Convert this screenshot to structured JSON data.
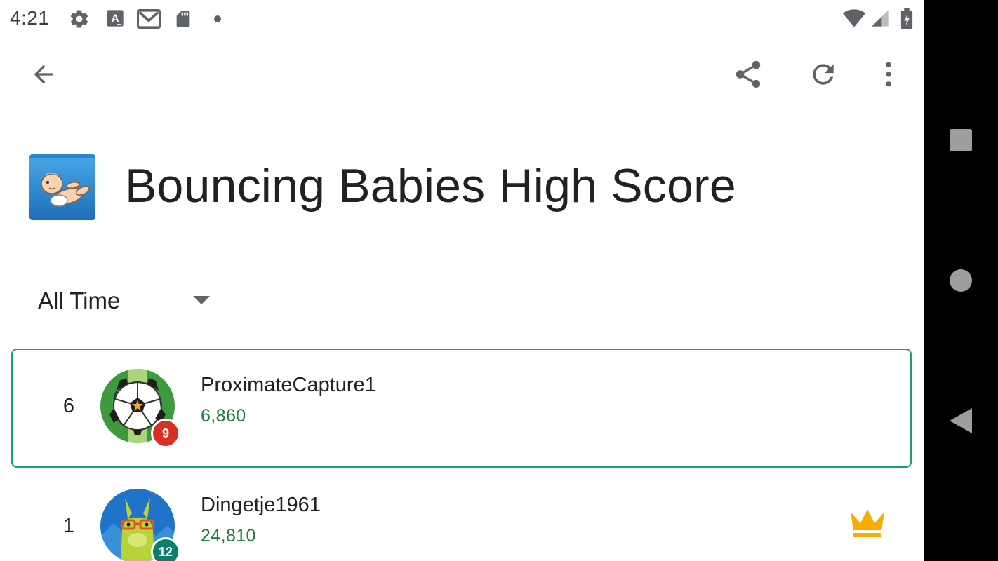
{
  "status_bar": {
    "time": "4:21",
    "icons": [
      "settings-icon",
      "font-a-icon",
      "gmail-icon",
      "sd-card-icon",
      "notification-dot-icon",
      "wifi-icon",
      "cell-signal-icon",
      "battery-icon"
    ]
  },
  "app_bar": {
    "back_icon": "arrow-back-icon",
    "actions": [
      "share-icon",
      "refresh-icon",
      "more-vert-icon"
    ]
  },
  "header": {
    "title": "Bouncing Babies High Score",
    "game_icon": "bouncing-babies-game-icon"
  },
  "filter": {
    "selected": "All Time"
  },
  "leaderboard": [
    {
      "rank": "6",
      "name": "ProximateCapture1",
      "score": "6,860",
      "level": "9",
      "avatar": "soccer-ball-avatar",
      "highlighted": true,
      "crown": false,
      "badge_color": "#d93025"
    },
    {
      "rank": "1",
      "name": "Dingetje1961",
      "score": "24,810",
      "level": "12",
      "avatar": "llama-avatar",
      "highlighted": false,
      "crown": true,
      "badge_color": "#0b7e6c"
    }
  ],
  "nav_bar": {
    "buttons": [
      "recents-square-icon",
      "home-circle-icon",
      "back-triangle-icon"
    ]
  },
  "colors": {
    "accent": "#1a9e78",
    "score": "#188038",
    "crown": "#f9ab00",
    "nav_bar": "#000000"
  }
}
